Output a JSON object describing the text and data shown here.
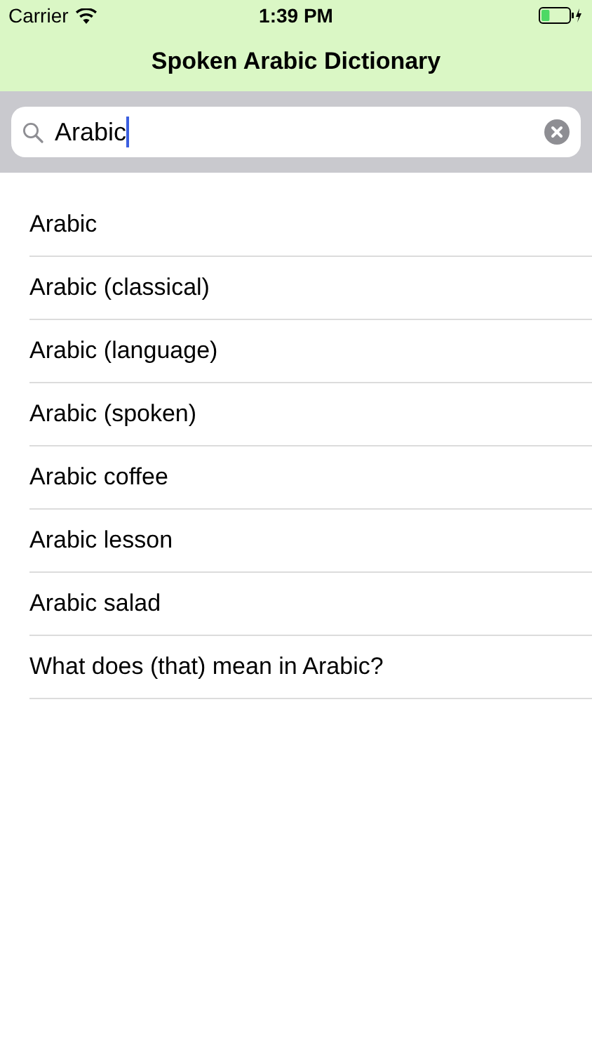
{
  "status_bar": {
    "carrier": "Carrier",
    "time": "1:39 PM",
    "battery": {
      "level": 0.3,
      "charging": true
    }
  },
  "nav_bar": {
    "title": "Spoken Arabic Dictionary"
  },
  "search": {
    "value": "Arabic",
    "focused": true
  },
  "results": [
    {
      "label": "Arabic"
    },
    {
      "label": "Arabic (classical)"
    },
    {
      "label": "Arabic (language)"
    },
    {
      "label": "Arabic (spoken)"
    },
    {
      "label": "Arabic coffee"
    },
    {
      "label": "Arabic lesson"
    },
    {
      "label": "Arabic salad"
    },
    {
      "label": "What does (that) mean in Arabic?"
    }
  ]
}
